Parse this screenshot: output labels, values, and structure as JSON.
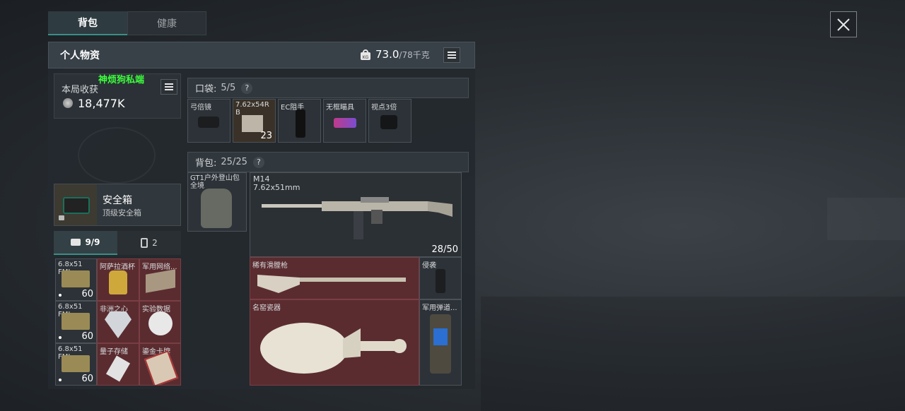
{
  "tabs": [
    {
      "label": "背包"
    },
    {
      "label": "健康"
    }
  ],
  "header": {
    "title": "个人物资",
    "weight_current": "73.0",
    "weight_max": "/78千克",
    "weight_icon": "kg-weight-icon"
  },
  "watermark": "神烦狗私端",
  "earnings": {
    "label": "本局收获",
    "value": "18,477K"
  },
  "safe_box": {
    "title": "安全箱",
    "subtitle": "顶级安全箱"
  },
  "container_tabs": [
    {
      "label": "9/9"
    },
    {
      "label": "2"
    }
  ],
  "stash_items": [
    {
      "label": "6.8x51 FMJ",
      "count": "60"
    },
    {
      "label": "阿萨拉酒杯",
      "count": ""
    },
    {
      "label": "军用网络...",
      "count": ""
    },
    {
      "label": "6.8x51 FMJ",
      "count": "60"
    },
    {
      "label": "非洲之心",
      "count": ""
    },
    {
      "label": "实验数据",
      "count": ""
    },
    {
      "label": "6.8x51 FMJ",
      "count": "60"
    },
    {
      "label": "量子存储",
      "count": ""
    },
    {
      "label": "鎏金卡牌",
      "count": ""
    }
  ],
  "pocket": {
    "label": "口袋:",
    "count": "5/5",
    "help": "?",
    "items": [
      {
        "label": "弓倍镜",
        "count": ""
      },
      {
        "label": "7.62x54R B",
        "count": "23"
      },
      {
        "label": "EC阻手",
        "count": ""
      },
      {
        "label": "无框瞄具",
        "count": ""
      },
      {
        "label": "视点3倍",
        "count": ""
      }
    ]
  },
  "backpack": {
    "label": "背包:",
    "count": "25/25",
    "help": "?",
    "bag_label": "GT1户外登山包 全境",
    "weapon": {
      "name": "M14",
      "caliber": "7.62x51mm",
      "ammo": "28/50"
    },
    "musket": {
      "label": "稀有滑膛枪"
    },
    "grip": {
      "label": "侵袭"
    },
    "vase": {
      "label": "名窑瓷器"
    },
    "radio": {
      "label": "军用弹道..."
    }
  },
  "colors": {
    "accent": "#3a8f86",
    "rare_red": "#5a2c30",
    "watermark": "#3cff3c"
  }
}
